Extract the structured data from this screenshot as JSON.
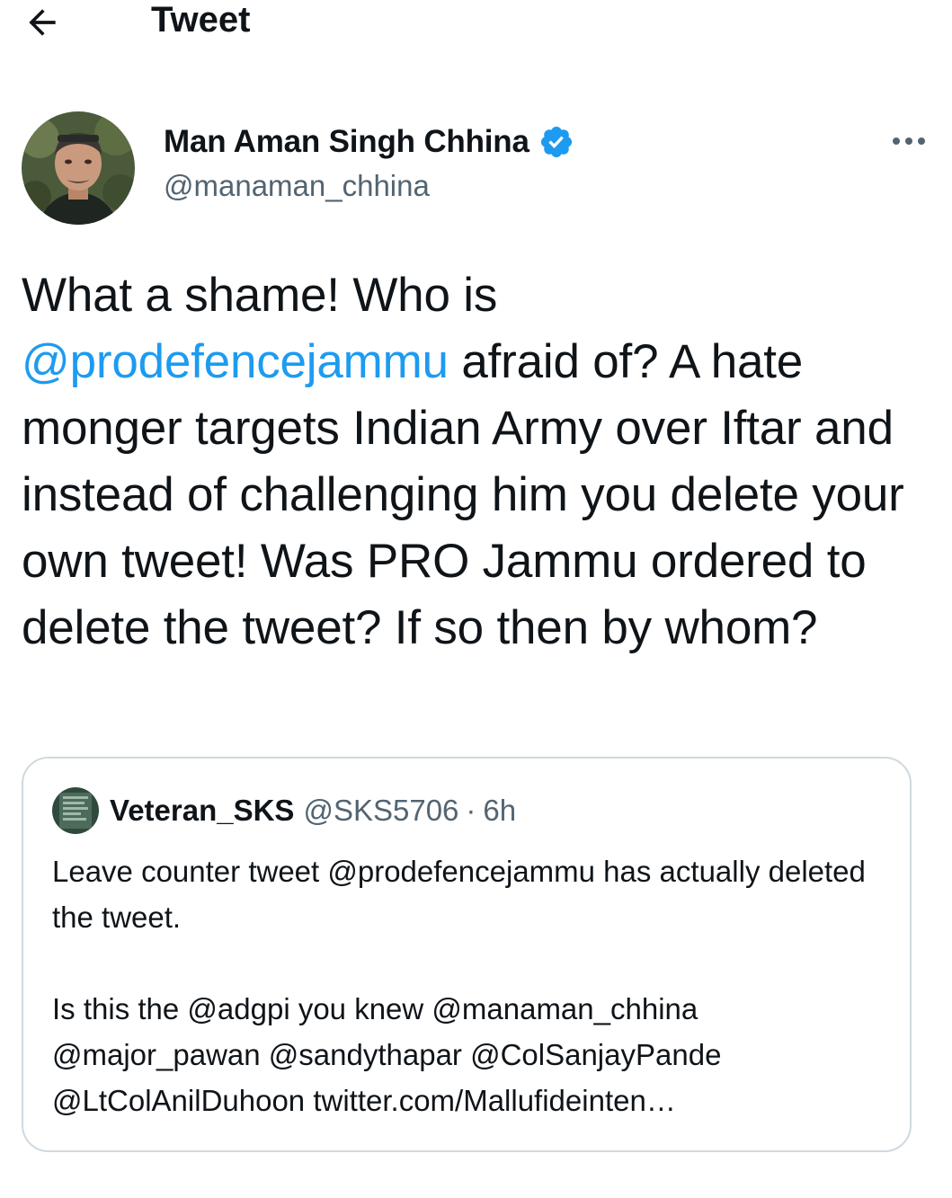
{
  "header": {
    "title": "Tweet",
    "back_icon": "arrow-left-icon"
  },
  "author": {
    "name": "Man Aman Singh Chhina",
    "handle": "@manaman_chhina",
    "verified": true,
    "verified_color": "#1d9bf0",
    "more_icon": "more-horizontal-icon"
  },
  "tweet": {
    "text_before": "What a shame! Who is",
    "mention": "@prodefencejammu",
    "text_after": " afraid of? A hate monger targets Indian Army over Iftar and instead of challenging him you delete your own tweet! Was PRO Jammu ordered to delete the tweet? If so then by whom?"
  },
  "quote": {
    "name": "Veteran_SKS",
    "handle": "@SKS5706",
    "separator": "·",
    "time": "6h",
    "paragraph_1": "Leave counter tweet @prodefencejammu has actually deleted the tweet.",
    "paragraph_2": "Is this the @adgpi you knew @manaman_chhina @major_pawan @sandythapar @ColSanjayPande @LtColAnilDuhoon twitter.com/Mallufideinten…"
  },
  "colors": {
    "text": "#0f1419",
    "secondary": "#536471",
    "link": "#1d9bf0",
    "border": "#cfd9de"
  }
}
